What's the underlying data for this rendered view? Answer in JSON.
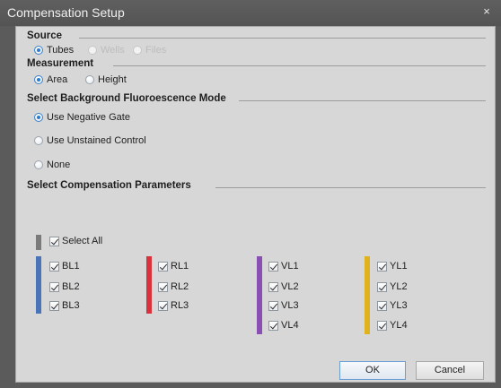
{
  "dialog": {
    "title": "Compensation Setup",
    "close_glyph": "×"
  },
  "source": {
    "title": "Source",
    "options": [
      {
        "label": "Tubes",
        "checked": true,
        "disabled": false
      },
      {
        "label": "Wells",
        "checked": false,
        "disabled": true
      },
      {
        "label": "Files",
        "checked": false,
        "disabled": true
      }
    ]
  },
  "measurement": {
    "title": "Measurement",
    "options": [
      {
        "label": "Area",
        "checked": true
      },
      {
        "label": "Height",
        "checked": false
      }
    ]
  },
  "background": {
    "title": "Select Background Fluoroescence Mode",
    "options": [
      {
        "label": "Use Negative Gate",
        "checked": true
      },
      {
        "label": "Use Unstained Control",
        "checked": false
      },
      {
        "label": "None",
        "checked": false
      }
    ]
  },
  "parameters": {
    "title": "Select Compensation Parameters",
    "select_all": {
      "label": "Select All",
      "checked": true,
      "color": "#7a7a7a"
    },
    "groups": [
      {
        "color": "#4a73b8",
        "items": [
          "BL1",
          "BL2",
          "BL3"
        ]
      },
      {
        "color": "#d9323c",
        "items": [
          "RL1",
          "RL2",
          "RL3"
        ]
      },
      {
        "color": "#8a4fb3",
        "items": [
          "VL1",
          "VL2",
          "VL3",
          "VL4"
        ]
      },
      {
        "color": "#e0b21e",
        "items": [
          "YL1",
          "YL2",
          "YL3",
          "YL4"
        ]
      }
    ]
  },
  "buttons": {
    "ok": "OK",
    "cancel": "Cancel"
  }
}
